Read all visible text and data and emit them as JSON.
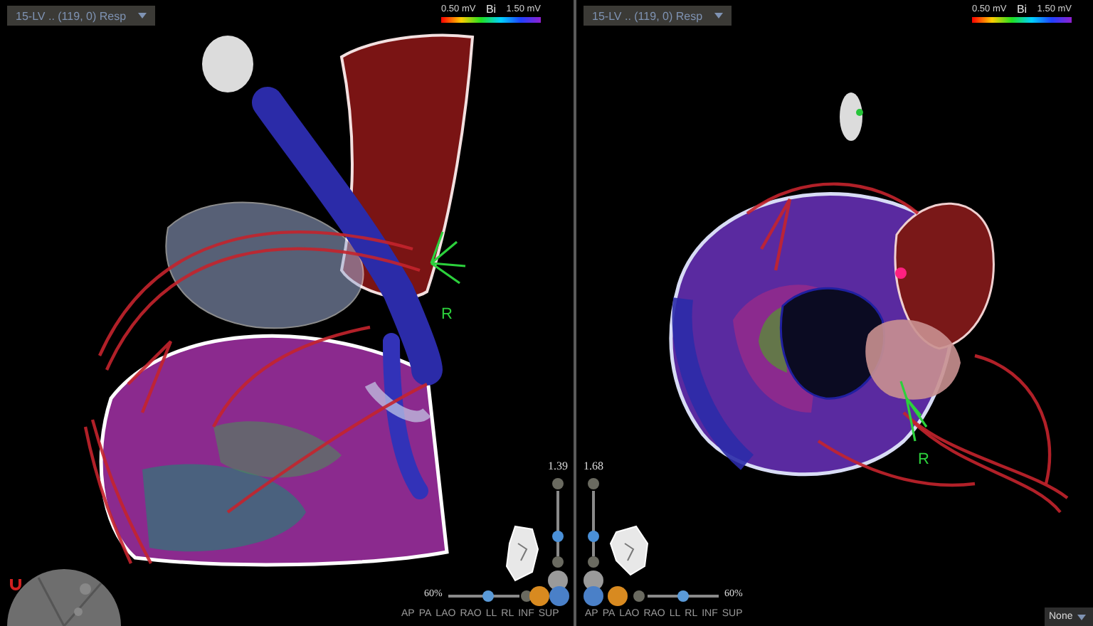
{
  "viewports": [
    {
      "kind": "left",
      "map_selector": "15-LV .. (119, 0) Resp",
      "legend": {
        "min": "0.50 mV",
        "mode": "Bi",
        "max": "1.50 mV"
      },
      "marker_label": "R",
      "zoom": {
        "reading": "1.39",
        "level": 0.3
      },
      "opacity": {
        "reading": "60%",
        "level": 0.55
      },
      "view_buttons": [
        "AP",
        "PA",
        "LAO",
        "RAO",
        "LL",
        "RL",
        "INF",
        "SUP"
      ]
    },
    {
      "kind": "right",
      "map_selector": "15-LV .. (119, 0) Resp",
      "legend": {
        "min": "0.50 mV",
        "mode": "Bi",
        "max": "1.50 mV"
      },
      "marker_label": "R",
      "zoom": {
        "reading": "1.68",
        "level": 0.3
      },
      "opacity": {
        "reading": "60%",
        "level": 0.5
      },
      "view_buttons": [
        "AP",
        "PA",
        "LAO",
        "RAO",
        "LL",
        "RL",
        "INF",
        "SUP"
      ]
    }
  ],
  "display_selector": "None"
}
